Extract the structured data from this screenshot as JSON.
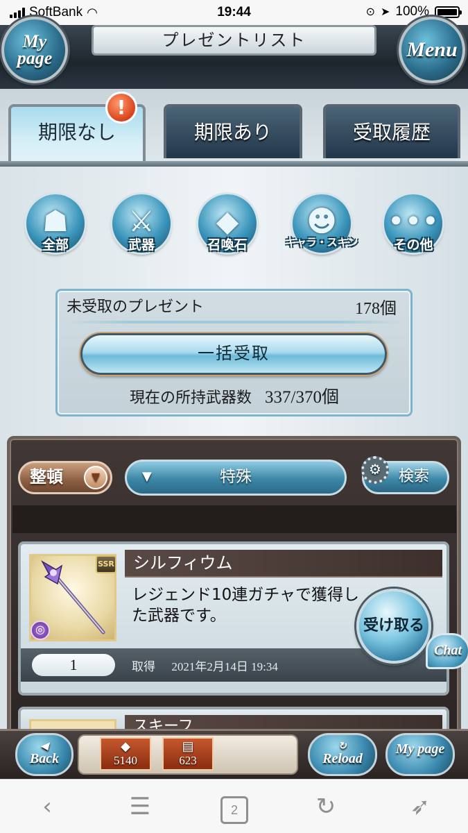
{
  "status_bar": {
    "carrier": "SoftBank",
    "time": "19:44",
    "battery": "100%"
  },
  "header": {
    "title": "プレゼントリスト",
    "mypage_label": "My page",
    "menu_label": "Menu"
  },
  "tabs": [
    {
      "label": "期限なし",
      "active": true
    },
    {
      "label": "期限あり",
      "active": false
    },
    {
      "label": "受取履歴",
      "active": false
    }
  ],
  "alert_badge": "!",
  "categories": [
    {
      "label": "全部",
      "icon": "all-icon"
    },
    {
      "label": "武器",
      "icon": "weapon-icon"
    },
    {
      "label": "召喚石",
      "icon": "summon-stone-icon"
    },
    {
      "label": "キャラ・スキン",
      "icon": "character-skin-icon"
    },
    {
      "label": "その他",
      "icon": "other-icon"
    }
  ],
  "summary": {
    "unreceived_label": "未受取のプレゼント",
    "unreceived_count": "178個",
    "receive_all_label": "一括受取",
    "weapon_count_label": "現在の所持武器数",
    "weapon_count_value": "337/370個"
  },
  "list_controls": {
    "sort_label": "整頓",
    "filter_value": "特殊",
    "search_label": "検索"
  },
  "items": [
    {
      "name": "シルフィウム",
      "rarity": "SSR",
      "description": "レジェンド10連ガチャで獲得した武器です。",
      "quantity": "1",
      "acquired_label": "取得",
      "acquired_at": "2021年2月14日 19:34",
      "receive_label": "受け取る"
    },
    {
      "name": "スキーフ"
    }
  ],
  "chat_label": "Chat",
  "footer": {
    "back_label": "Back",
    "reload_label": "Reload",
    "mypage_label": "My page",
    "crystal_count": "5140",
    "ticket_count": "623"
  },
  "browser": {
    "tab_count": "2"
  },
  "colors": {
    "accent_blue": "#3d86a6",
    "panel_dark": "#2c2523",
    "alert_orange": "#d9431c"
  }
}
